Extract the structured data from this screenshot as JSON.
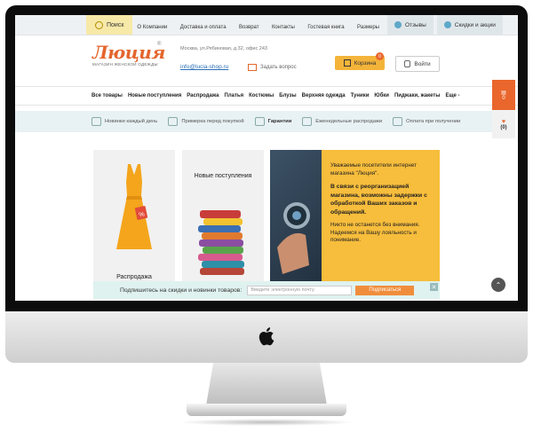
{
  "topbar": {
    "search": "Поиск",
    "links": [
      "О Компании",
      "Доставка и оплата",
      "Возврат",
      "Контакты",
      "Гостевая книга",
      "Размеры"
    ],
    "reviews": "Отзывы",
    "discounts": "Скидки и акции"
  },
  "header": {
    "logo_word": "Люция",
    "logo_tagline": "МАГАЗИН ЖЕНСКОЙ ОДЕЖДЫ",
    "logo_reg": "®",
    "address": "Москва, ул.Рябиновая, д.32, офис 243",
    "email": "info@lucia-shop.ru",
    "ask": "Задать вопрос",
    "cart_label": "Корзина",
    "cart_count": "0",
    "login": "Войти"
  },
  "categories": [
    "Все товары",
    "Новые поступления",
    "Распродажа",
    "Платья",
    "Костюмы",
    "Блузы",
    "Верхняя одежда",
    "Туники",
    "Юбки",
    "Пиджаки, жакеты",
    "Еще -"
  ],
  "side_widget": {
    "cart_count": "0",
    "wish_count": "(0)"
  },
  "benefits": [
    "Новинки каждый день",
    "Примерка перед покупкой",
    "Гарантии",
    "Еженедельные распродажи",
    "Оплата при получении"
  ],
  "banners": {
    "sale": "Распродажа",
    "new": "Новые поступления",
    "notice_1": "Уважаемые посетители интернет магазина \"Люция\".",
    "notice_2": "В связи с реорганизацией магазина, возможны задержки с обработкой Ваших заказов и обращений.",
    "notice_3": "Никто не останется без внимания. Надеемся на Вашу лояльность и понимание."
  },
  "subscribe": {
    "label": "Подпишитесь на скидки и новинки товаров:",
    "placeholder": "Введите электронную почту",
    "button": "Подписаться",
    "close": "✕"
  },
  "colors": {
    "accent": "#e9662c",
    "cart": "#f4b43a",
    "notice_bg": "#f7bd3c"
  }
}
